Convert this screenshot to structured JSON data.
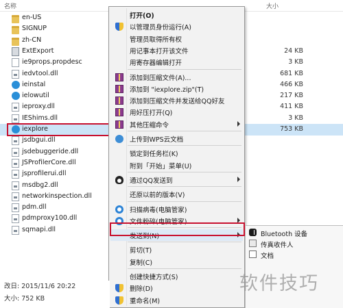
{
  "header": {
    "name_col": "名称",
    "size_col": "大小"
  },
  "files": [
    {
      "name": "en-US",
      "size": "",
      "icon": "folder-icon",
      "kind": "folder"
    },
    {
      "name": "SIGNUP",
      "size": "",
      "icon": "folder-icon",
      "kind": "folder"
    },
    {
      "name": "zh-CN",
      "size": "",
      "icon": "folder-icon",
      "kind": "folder"
    },
    {
      "name": "ExtExport",
      "size": "24 KB",
      "icon": "executable-icon",
      "kind": "exe"
    },
    {
      "name": "ie9props.propdesc",
      "size": "3 KB",
      "icon": "document-icon",
      "kind": "doc"
    },
    {
      "name": "iedvtool.dll",
      "size": "681 KB",
      "icon": "dll-icon",
      "kind": "dll"
    },
    {
      "name": "ieinstal",
      "size": "466 KB",
      "icon": "ie-icon",
      "kind": "ie"
    },
    {
      "name": "ielowutil",
      "size": "217 KB",
      "icon": "ie-icon",
      "kind": "ie"
    },
    {
      "name": "ieproxy.dll",
      "size": "411 KB",
      "icon": "dll-icon",
      "kind": "dll"
    },
    {
      "name": "IEShims.dll",
      "size": "3 KB",
      "icon": "dll-icon",
      "kind": "dll"
    },
    {
      "name": "iexplore",
      "size": "753 KB",
      "icon": "ie-icon",
      "kind": "ie",
      "selected": true
    },
    {
      "name": "jsdbgui.dll",
      "size": "",
      "icon": "dll-icon",
      "kind": "dll"
    },
    {
      "name": "jsdebuggeride.dll",
      "size": "",
      "icon": "dll-icon",
      "kind": "dll"
    },
    {
      "name": "JSProfilerCore.dll",
      "size": "",
      "icon": "dll-icon",
      "kind": "dll"
    },
    {
      "name": "jsprofilerui.dll",
      "size": "",
      "icon": "dll-icon",
      "kind": "dll"
    },
    {
      "name": "msdbg2.dll",
      "size": "",
      "icon": "dll-icon",
      "kind": "dll"
    },
    {
      "name": "networkinspection.dll",
      "size": "",
      "icon": "dll-icon",
      "kind": "dll"
    },
    {
      "name": "pdm.dll",
      "size": "",
      "icon": "dll-icon",
      "kind": "dll"
    },
    {
      "name": "pdmproxy100.dll",
      "size": "",
      "icon": "dll-icon",
      "kind": "dll"
    },
    {
      "name": "sqmapi.dll",
      "size": "",
      "icon": "dll-icon",
      "kind": "dll"
    }
  ],
  "menu": {
    "items": [
      {
        "label": "打开(O)",
        "bold": true,
        "icon": "",
        "arrow": false
      },
      {
        "label": "以管理员身份运行(A)",
        "icon": "shield-icon",
        "arrow": false
      },
      {
        "label": "管理员取得所有权",
        "icon": "",
        "arrow": false
      },
      {
        "label": "用记事本打开该文件",
        "icon": "",
        "arrow": false
      },
      {
        "label": "用寄存器编辑打开",
        "icon": "",
        "arrow": false
      },
      {
        "label": "添加到压缩文件(A)...",
        "icon": "archive-icon",
        "arrow": false
      },
      {
        "label": "添加到 \"iexplore.zip\"(T)",
        "icon": "archive-icon",
        "arrow": false
      },
      {
        "label": "添加到压缩文件并发送给QQ好友",
        "icon": "archive-icon",
        "arrow": false
      },
      {
        "label": "用好压打开(Q)",
        "icon": "archive-icon",
        "arrow": false
      },
      {
        "label": "其他压缩命令",
        "icon": "archive-icon",
        "arrow": true
      },
      {
        "label": "上传到WPS云文档",
        "icon": "cloud-icon",
        "arrow": false
      },
      {
        "label": "锁定到任务栏(K)",
        "icon": "",
        "arrow": false
      },
      {
        "label": "附到「开始」菜单(U)",
        "icon": "",
        "arrow": false
      },
      {
        "label": "通过QQ发送到",
        "icon": "qq-penguin-icon",
        "arrow": true
      },
      {
        "label": "还原以前的版本(V)",
        "icon": "",
        "arrow": false
      },
      {
        "label": "扫描病毒(电脑管家)",
        "icon": "pc-manager-icon",
        "arrow": false
      },
      {
        "label": "文件粉碎(电脑管家)",
        "icon": "pc-manager-icon",
        "arrow": true
      },
      {
        "label": "发送到(N)",
        "icon": "",
        "arrow": true,
        "highlighted": true
      },
      {
        "label": "剪切(T)",
        "icon": "",
        "arrow": false
      },
      {
        "label": "复制(C)",
        "icon": "",
        "arrow": false
      },
      {
        "label": "创建快捷方式(S)",
        "icon": "",
        "arrow": false
      },
      {
        "label": "删除(D)",
        "icon": "shield-icon",
        "arrow": false
      },
      {
        "label": "重命名(M)",
        "icon": "shield-icon",
        "arrow": false
      }
    ]
  },
  "submenu": {
    "items": [
      {
        "label": "Bluetooth 设备",
        "icon": "bluetooth-icon"
      },
      {
        "label": "传真收件人",
        "icon": "fax-icon"
      },
      {
        "label": "文档",
        "icon": "documents-icon"
      }
    ]
  },
  "status": {
    "date_line": "改日: 2015/11/6 20:22",
    "size_line": "大小: 752 KB"
  },
  "watermark": "软件技巧"
}
